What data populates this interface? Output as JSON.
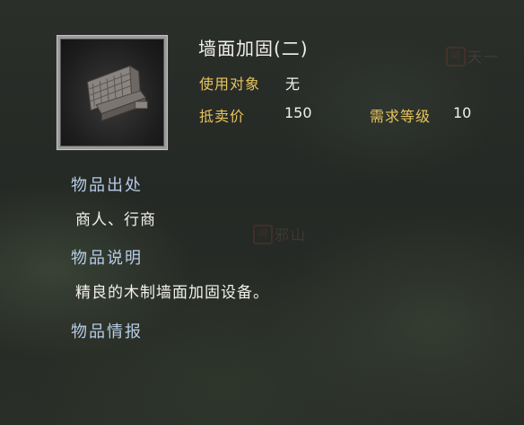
{
  "item": {
    "name": "墙面加固(二)",
    "use_target_label": "使用对象",
    "use_target_value": "无",
    "sell_price_label": "抵卖价",
    "sell_price_value": "150",
    "required_level_label": "需求等级",
    "required_level_value": "10"
  },
  "sections": {
    "origin_heading": "物品出处",
    "origin_text": "商人、行商",
    "desc_heading": "物品说明",
    "desc_text": "精良的木制墙面加固设备。",
    "info_heading": "物品情报"
  },
  "background_map": {
    "label_top_right": "天一",
    "label_center": "邪山"
  },
  "colors": {
    "label_gold": "#e7c45b",
    "heading_blue": "#b7cce6",
    "text_white": "#f2f0ec"
  }
}
